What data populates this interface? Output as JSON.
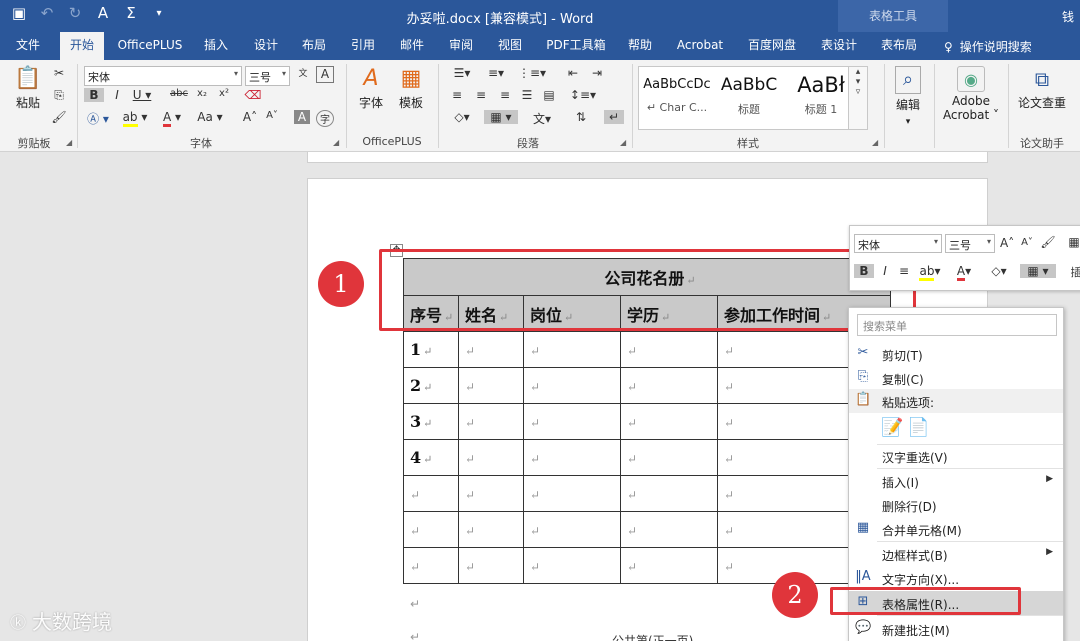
{
  "titlebar": {
    "doc_title": "办妥啦.docx [兼容模式] - Word",
    "context_title": "表格工具",
    "user": "钱"
  },
  "tabs": [
    {
      "label": "文件"
    },
    {
      "label": "开始"
    },
    {
      "label": "OfficePLUS"
    },
    {
      "label": "插入"
    },
    {
      "label": "设计"
    },
    {
      "label": "布局"
    },
    {
      "label": "引用"
    },
    {
      "label": "邮件"
    },
    {
      "label": "审阅"
    },
    {
      "label": "视图"
    },
    {
      "label": "PDF工具箱"
    },
    {
      "label": "帮助"
    },
    {
      "label": "Acrobat"
    },
    {
      "label": "百度网盘"
    },
    {
      "label": "表设计"
    },
    {
      "label": "表布局"
    }
  ],
  "tell_me": "操作说明搜索",
  "ribbon": {
    "paste_label": "粘贴",
    "font_name": "宋体",
    "font_size": "三号",
    "font_btn": "字体",
    "template_btn": "模板",
    "style_previews": [
      {
        "preview": "AaBbCcDc",
        "name": "↵ Char C..."
      },
      {
        "preview": "AaBbC",
        "name": "标题"
      },
      {
        "preview": "AaBł",
        "name": "标题 1"
      }
    ],
    "edit_btn": "编辑",
    "adobe_btn_l1": "Adobe",
    "adobe_btn_l2": "Acrobat ˅",
    "check_btn": "论文查重",
    "groups": {
      "clipboard": "剪贴板",
      "font": "字体",
      "officeplus": "OfficePLUS",
      "paragraph": "段落",
      "styles": "样式",
      "assistant": "论文助手"
    }
  },
  "document": {
    "table_title": "公司花名册",
    "headers": [
      "序号",
      "姓名",
      "岗位",
      "学历",
      "参加工作时间"
    ],
    "row_numbers": [
      "1",
      "2",
      "3",
      "4",
      "",
      "",
      ""
    ],
    "return_mark": "↵",
    "footer": "公共第(正一页)"
  },
  "annotations": {
    "badge1": "1",
    "badge2": "2"
  },
  "mini_toolbar": {
    "font_name": "宋体",
    "font_size": "三号",
    "insert_label": "插"
  },
  "context_menu": {
    "search_placeholder": "搜索菜单",
    "items": [
      {
        "label": "剪切(T)"
      },
      {
        "label": "复制(C)"
      },
      {
        "label": "粘贴选项:"
      },
      {
        "label": "汉字重选(V)"
      },
      {
        "label": "插入(I)"
      },
      {
        "label": "删除行(D)"
      },
      {
        "label": "合并单元格(M)"
      },
      {
        "label": "边框样式(B)"
      },
      {
        "label": "文字方向(X)..."
      },
      {
        "label": "表格属性(R)..."
      },
      {
        "label": "新建批注(M)"
      }
    ]
  },
  "watermark": "大数跨境",
  "colors": {
    "word_blue": "#2b579a",
    "annotation_red": "#e0353b",
    "header_gray": "#c9c9c9"
  }
}
